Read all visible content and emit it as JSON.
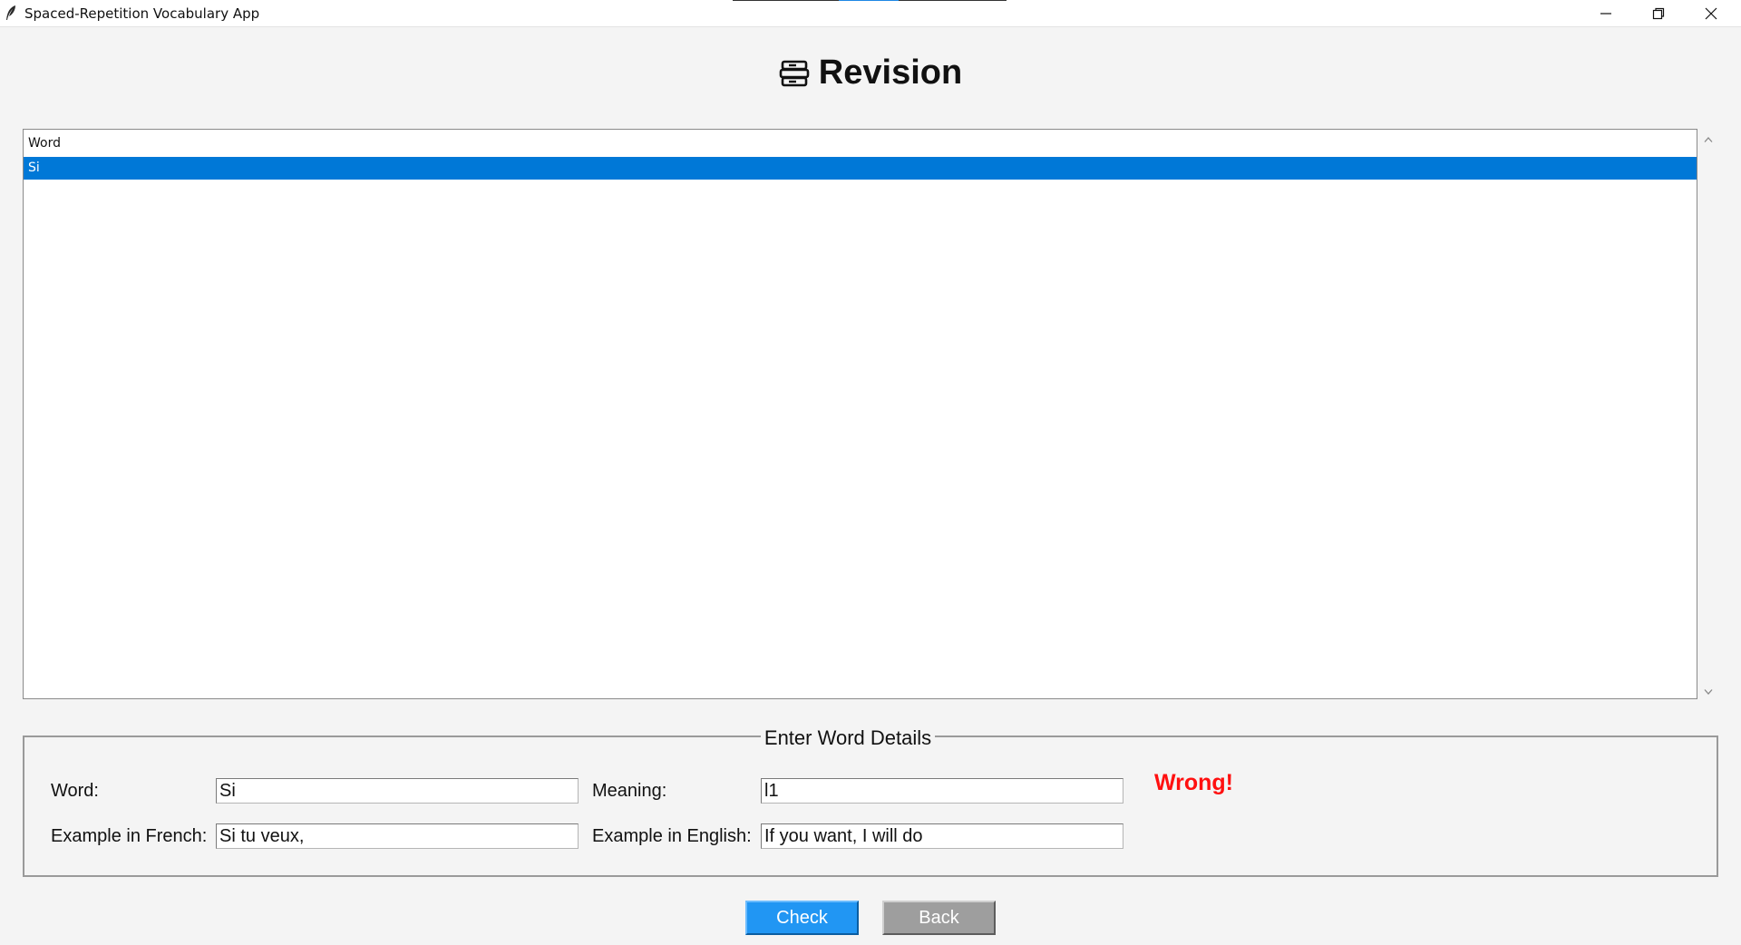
{
  "window": {
    "title": "Spaced-Repetition Vocabulary App"
  },
  "heading": {
    "icon": "card-index-icon",
    "text": "Revision"
  },
  "word_list": {
    "column_header": "Word",
    "rows": [
      "Si"
    ],
    "selected_index": 0
  },
  "form": {
    "legend": "Enter Word Details",
    "word_label": "Word:",
    "word_value": "Si",
    "meaning_label": "Meaning:",
    "meaning_value": "l1",
    "example_fr_label": "Example in French:",
    "example_fr_value": "Si tu veux,",
    "example_en_label": "Example in English:",
    "example_en_value": "If you want, I will do",
    "status_text": "Wrong!"
  },
  "buttons": {
    "check_label": "Check",
    "back_label": "Back"
  },
  "colors": {
    "selection": "#0078d7",
    "check_button": "#2196f3",
    "back_button": "#9e9e9e",
    "status_wrong": "#ff1010"
  }
}
